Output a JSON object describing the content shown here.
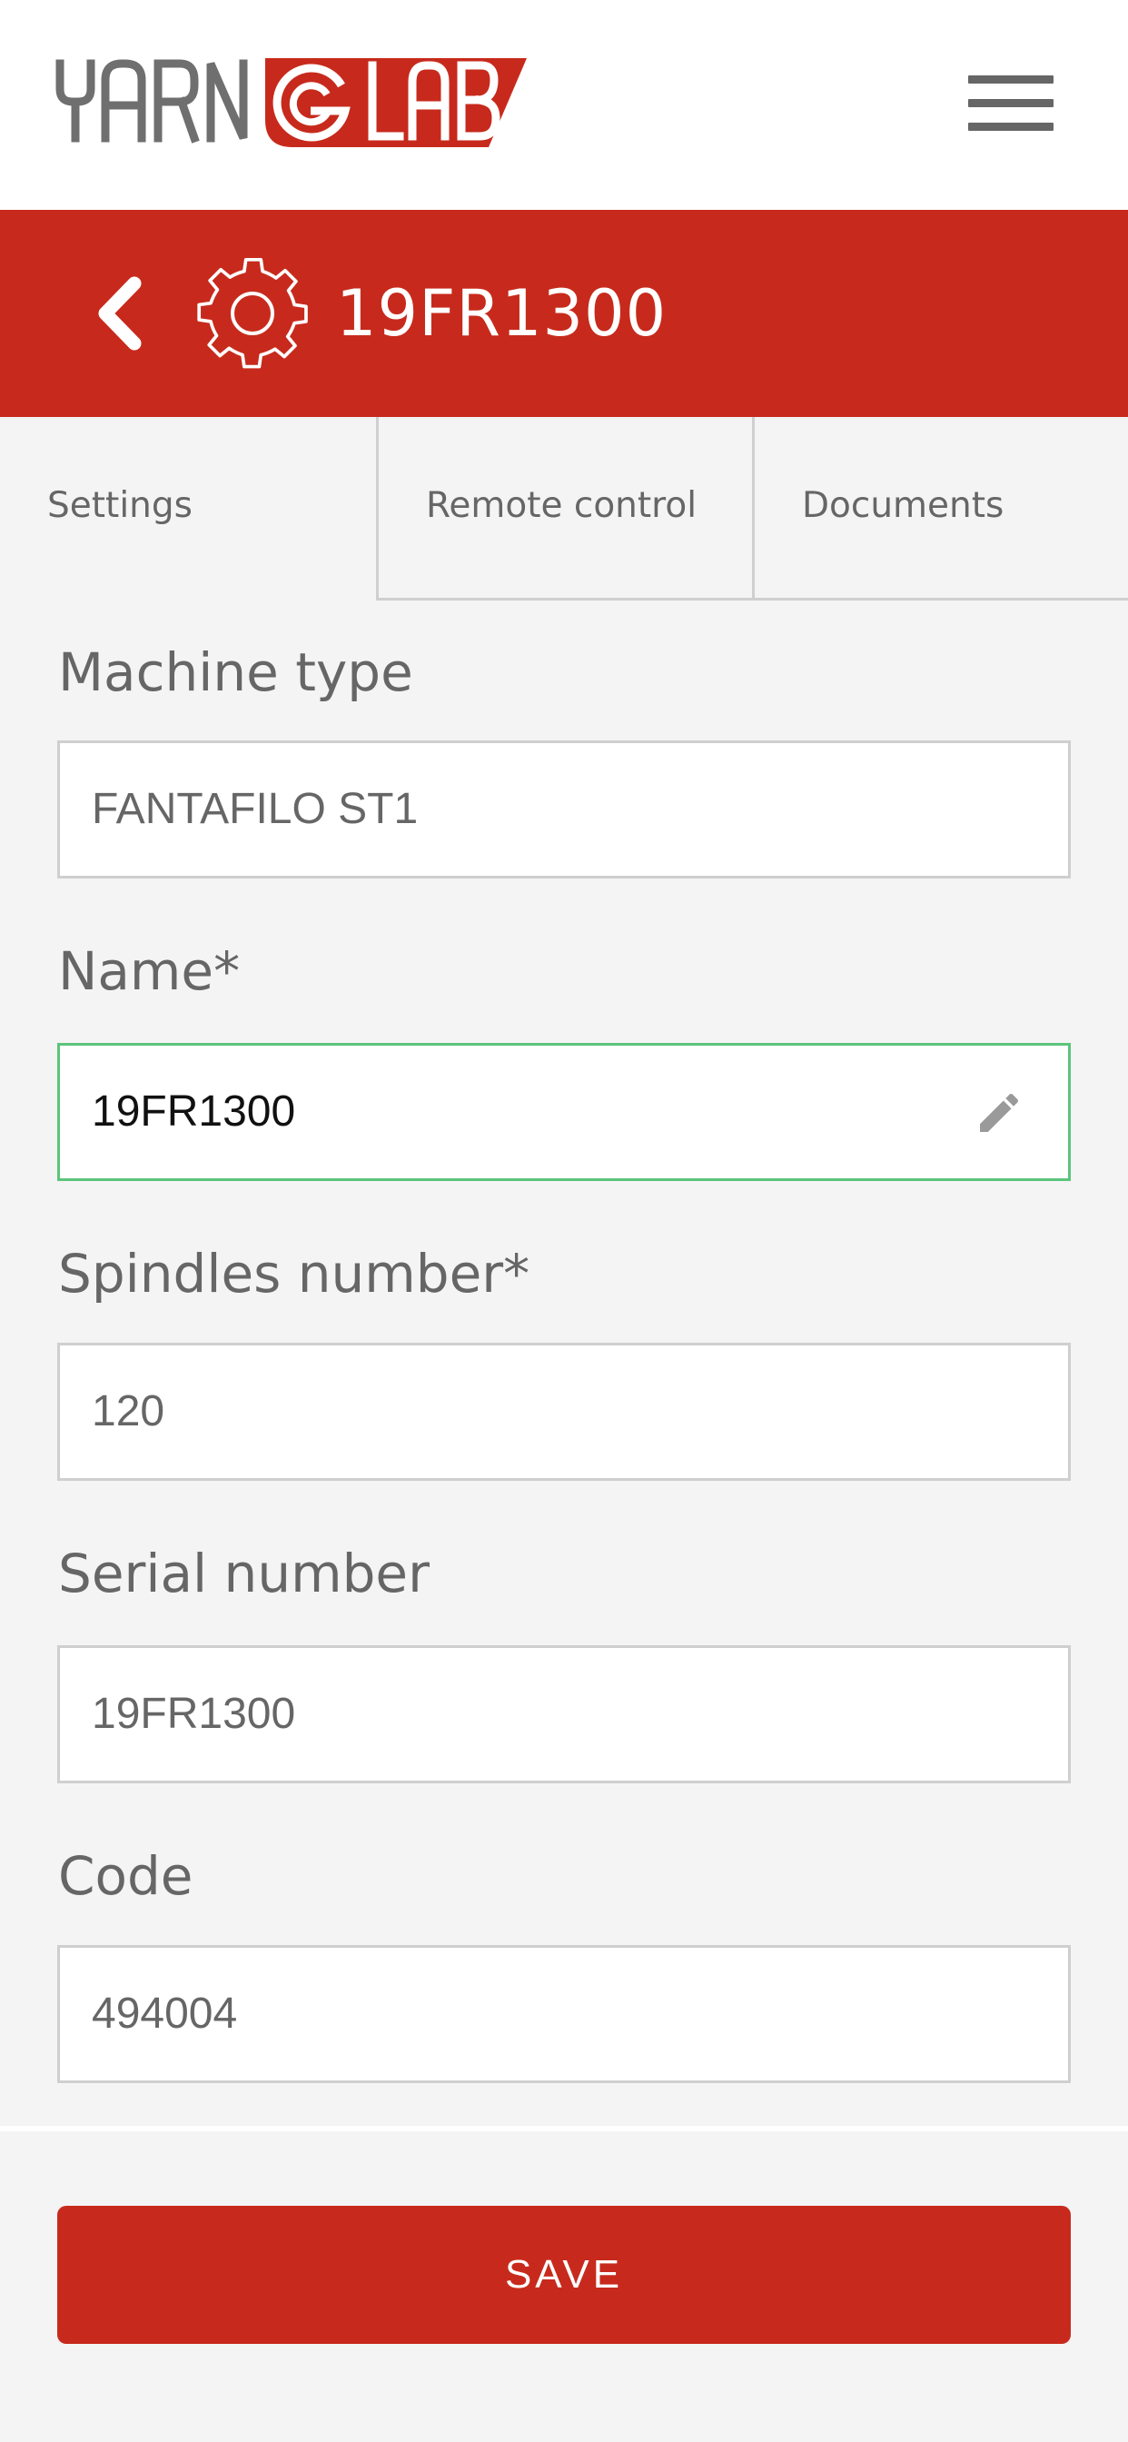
{
  "header": {
    "logo_text": "YARN G LAB",
    "menu_icon": "hamburger-menu-icon"
  },
  "title_bar": {
    "title": "19FR1300",
    "back_icon": "chevron-left-icon",
    "settings_icon": "gear-icon"
  },
  "tabs": [
    {
      "label": "Settings",
      "active": true
    },
    {
      "label": "Remote control",
      "active": false
    },
    {
      "label": "Documents",
      "active": false
    }
  ],
  "form": {
    "machine_type": {
      "label": "Machine type",
      "value": "FANTAFILO ST1"
    },
    "name": {
      "label": "Name*",
      "value": "19FR1300",
      "edit_icon": "pencil-icon"
    },
    "spindles_number": {
      "label": "Spindles number*",
      "value": "120"
    },
    "serial_number": {
      "label": "Serial number",
      "value": "19FR1300"
    },
    "code": {
      "label": "Code",
      "value": "494004"
    }
  },
  "actions": {
    "save_label": "SAVE"
  },
  "colors": {
    "brand_red": "#c72a1c",
    "focus_green": "#5cc47a",
    "text_gray": "#666666",
    "logo_gray": "#6f6f6f"
  }
}
